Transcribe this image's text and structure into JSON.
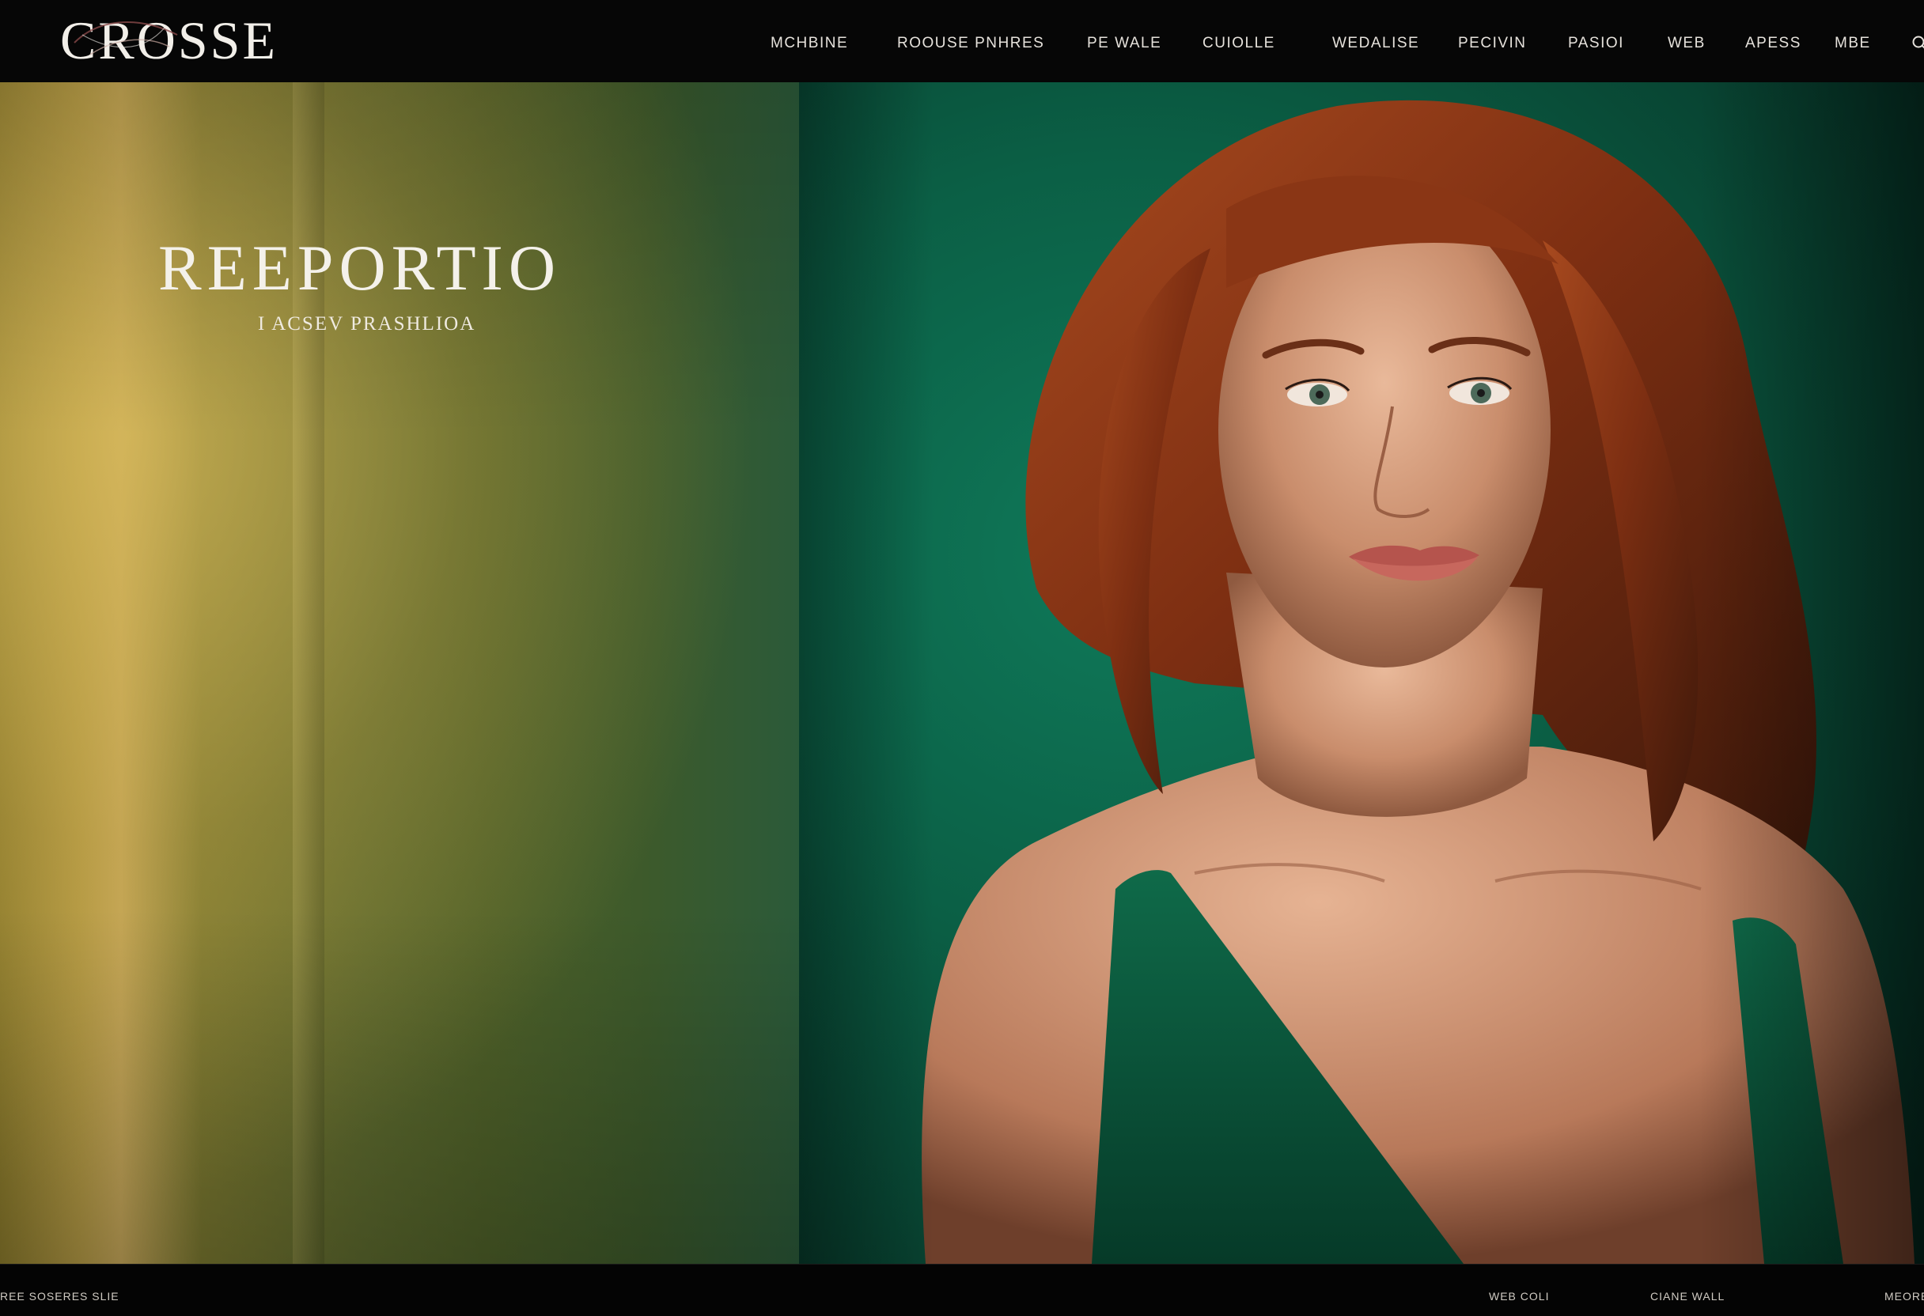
{
  "brand": {
    "logo_text": "CROSSE"
  },
  "nav": {
    "items": [
      {
        "label": "MCHBINE"
      },
      {
        "label": "ROOUSE PNHRES"
      },
      {
        "label": "PE WALE"
      },
      {
        "label": "CUIOLLE"
      },
      {
        "label": "WEDALISE"
      },
      {
        "label": "PECIVIN"
      },
      {
        "label": "PASIOI"
      },
      {
        "label": "WEB"
      },
      {
        "label": "APESS"
      },
      {
        "label": "MBE"
      }
    ],
    "search_icon": "search-icon"
  },
  "hero": {
    "title": "REEPORTIO",
    "subtitle": "I ACSEV PRASHLIOA",
    "colors": {
      "left_backdrop": "#6b7230",
      "right_backdrop": "#0b5f45",
      "dress": "#0d5a3e",
      "hair": "#8e3a16"
    }
  },
  "footer": {
    "left_label": "REE SOSERES SLIE",
    "links": [
      {
        "label": "WEB COLI"
      },
      {
        "label": "CIANE WALL"
      },
      {
        "label": "MEORE"
      }
    ]
  }
}
